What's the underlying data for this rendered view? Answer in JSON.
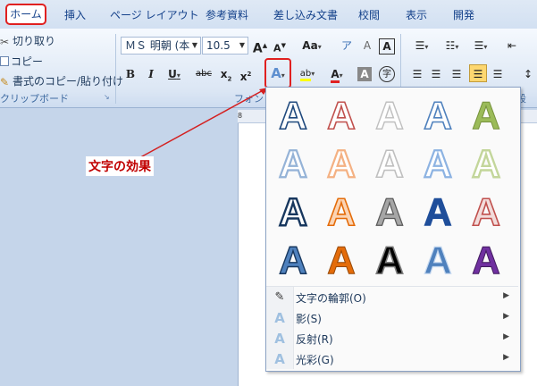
{
  "tabs": [
    {
      "label": "ホーム"
    },
    {
      "label": "挿入"
    },
    {
      "label": "ページ レイアウト"
    },
    {
      "label": "参考資料"
    },
    {
      "label": "差し込み文書"
    },
    {
      "label": "校閲"
    },
    {
      "label": "表示"
    },
    {
      "label": "開発"
    }
  ],
  "clipboard": {
    "cut": "切り取り",
    "copy": "コピー",
    "format_painter": "書式のコピー/貼り付け",
    "group_label": "クリップボード"
  },
  "font": {
    "name": "ＭＳ 明朝 (本",
    "size": "10.5",
    "group_label": "フォント",
    "grow": "A",
    "shrink": "A",
    "change_case": "Aa",
    "bold": "B",
    "italic": "I",
    "underline": "U",
    "strike": "abc",
    "subscript": "x",
    "superscript": "x",
    "text_effect": "A",
    "highlight": "ab",
    "font_color": "A",
    "char_shading": "A",
    "enclose": "字",
    "clear": "A",
    "phonetic": "ア",
    "border_char": "A"
  },
  "paragraph_group_label": "段",
  "annotation": {
    "label": "文字の効果"
  },
  "gallery": {
    "glyph": "A",
    "submenu": [
      {
        "label": "文字の輪郭(O)",
        "icon": "outline-pen-icon"
      },
      {
        "label": "影(S)",
        "icon": "shadow-a-icon"
      },
      {
        "label": "反射(R)",
        "icon": "reflection-a-icon"
      },
      {
        "label": "光彩(G)",
        "icon": "glow-a-icon"
      }
    ]
  },
  "colors": {
    "accent_red": "#e02020",
    "ribbon_text": "#15428b",
    "annotation_text": "#c00000"
  }
}
